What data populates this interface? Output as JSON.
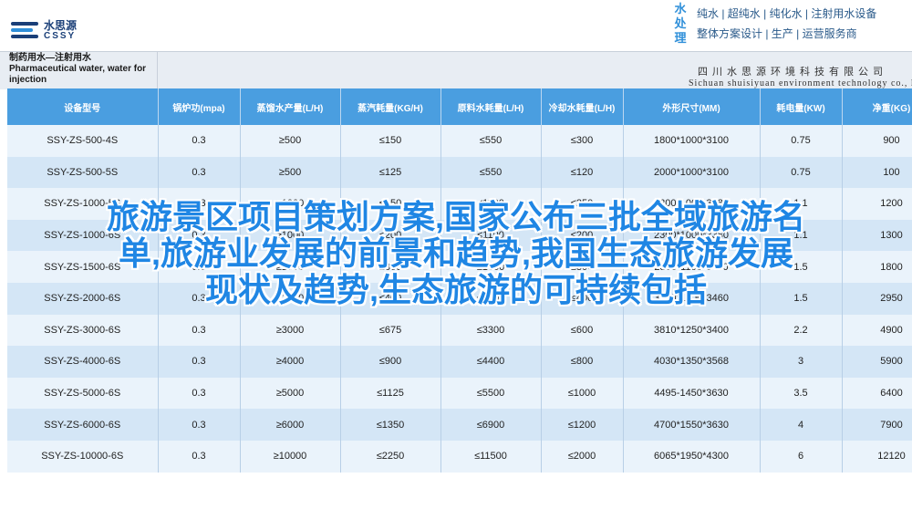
{
  "brand": {
    "name_cn": "水思源",
    "name_en": "CSSY",
    "slogan_side": "水处理",
    "slogan_line1": "纯水 | 超纯水 | 纯化水 | 注射用水设备",
    "slogan_line2": "整体方案设计 | 生产 | 运营服务商"
  },
  "banner": {
    "title_cn": "制药用水—注射用水",
    "title_en": "Pharmaceutical water, water for injection",
    "company_cn": "四川水思源环境科技有限公司",
    "company_en": "Sichuan shuisiyuan environment technology co., ltd"
  },
  "table": {
    "headers": [
      "设备型号",
      "锅炉功(mpa)",
      "蒸馏水产量(L/H)",
      "蒸汽耗量(KG/H)",
      "原料水耗量(L/H)",
      "冷却水耗量(L/H)",
      "外形尺寸(MM)",
      "耗电量(KW)",
      "净重(KG)"
    ],
    "rows": [
      [
        "SSY-ZS-500-4S",
        "0.3",
        "≥500",
        "≤150",
        "≤550",
        "≤300",
        "1800*1000*3100",
        "0.75",
        "900"
      ],
      [
        "SSY-ZS-500-5S",
        "0.3",
        "≥500",
        "≤125",
        "≤550",
        "≤120",
        "2000*1000*3100",
        "0.75",
        "100"
      ],
      [
        "SSY-ZS-1000-5S",
        "0.3",
        "≥1000",
        "≤250",
        "≤1100",
        "≤250",
        "2200*1000*3380",
        "1.1",
        "1200"
      ],
      [
        "SSY-ZS-1000-6S",
        "0.3",
        "≥1000",
        "≤200",
        "≤1100",
        "≤200",
        "2300*1000*3380",
        "1.1",
        "1300"
      ],
      [
        "SSY-ZS-1500-6S",
        "0.3",
        "≥1500",
        "≤300",
        "≤1650",
        "≤300",
        "2800*1100*3460",
        "1.5",
        "1800"
      ],
      [
        "SSY-ZS-2000-6S",
        "0.3",
        "≥2000",
        "≤400",
        "≤2200",
        "≤400",
        "3200*1200*3460",
        "1.5",
        "2950"
      ],
      [
        "SSY-ZS-3000-6S",
        "0.3",
        "≥3000",
        "≤675",
        "≤3300",
        "≤600",
        "3810*1250*3400",
        "2.2",
        "4900"
      ],
      [
        "SSY-ZS-4000-6S",
        "0.3",
        "≥4000",
        "≤900",
        "≤4400",
        "≤800",
        "4030*1350*3568",
        "3",
        "5900"
      ],
      [
        "SSY-ZS-5000-6S",
        "0.3",
        "≥5000",
        "≤1125",
        "≤5500",
        "≤1000",
        "4495-1450*3630",
        "3.5",
        "6400"
      ],
      [
        "SSY-ZS-6000-6S",
        "0.3",
        "≥6000",
        "≤1350",
        "≤6900",
        "≤1200",
        "4700*1550*3630",
        "4",
        "7900"
      ],
      [
        "SSY-ZS-10000-6S",
        "0.3",
        "≥10000",
        "≤2250",
        "≤11500",
        "≤2000",
        "6065*1950*4300",
        "6",
        "12120"
      ]
    ]
  },
  "overlay": {
    "line1": "旅游景区项目策划方案,国家公布三批全域旅游名",
    "line2": "单,旅游业发展的前景和趋势,我国生态旅游发展",
    "line3": "现状及趋势,生态旅游的可持续包括"
  },
  "colors": {
    "header_bg": "#4a9ee0",
    "row_light": "#eaf3fb",
    "row_dark": "#d4e6f6",
    "overlay_text": "#1f86e4",
    "brand_blue": "#1a3f78"
  }
}
